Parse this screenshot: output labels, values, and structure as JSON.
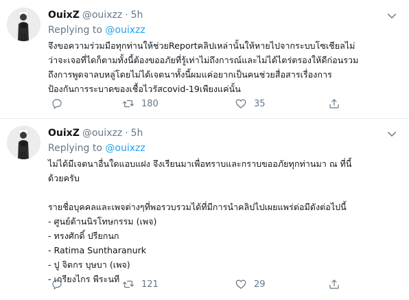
{
  "tweets": [
    {
      "author": {
        "name": "OuixZ",
        "handle": "@ouixzz",
        "time": "5h"
      },
      "replying": {
        "label": "Replying to",
        "mention": "@ouixzz"
      },
      "lines": [
        "จึงขอความร่วมมือทุกท่านให้ช่วยReportคลิปเหล่านั้นให้หายไปจากระบบโซเชียลไม่",
        "ว่าจะเจอที่ไดก็ตามทั้งนี้ต้องขออภัยที่รู้เท่าไม่ถึงการณ์และไม่ได้ไตร่ตรองให้ดีก่อนรวม",
        "ถึงการพูดจาลบหลู่โดยไม่ได้เจตนาทั้งนี้ผมแค่อยากเป็นคนช่วยสื่อสารเรื่องการ",
        "ป้องกันการระบาดของเชื้อไวรัสcovid-19เพียงแค่นั้น"
      ],
      "stats": {
        "retweets": "180",
        "likes": "35"
      }
    },
    {
      "author": {
        "name": "OuixZ",
        "handle": "@ouixzz",
        "time": "5h"
      },
      "replying": {
        "label": "Replying to",
        "mention": "@ouixzz"
      },
      "lines": [
        "ไม่ได้มีเจตนาอื่นใดแอบแฝง จึงเรียนมาเพื่อทราบและกราบขออภัยทุกท่านมา ณ ที่นี้",
        "ด้วยครับ",
        "รายชื่อบุคคลและเพจต่างๆที่พอรวบรวมได้ที่มีการนำคลิปไปเผยแพร่ต่อมีดังต่อไปนี้",
        "- ศูนย์ต้านนิรโทษกรรม (เพจ)",
        "- ทรงศักดิ์ ปรียกนก",
        "- Ratima Suntharanurk",
        "- ปู จิตกร บุษบา (เพจ)",
        "- เกรียงไกร พีระนที"
      ],
      "stats": {
        "retweets": "121",
        "likes": "29"
      }
    }
  ],
  "icons": {
    "caret": "chevron-down-icon",
    "reply": "reply-icon",
    "retweet": "retweet-icon",
    "like": "heart-icon",
    "share": "share-icon"
  },
  "colors": {
    "text": "#0f1419",
    "secondary": "#657786",
    "link": "#1da1f2",
    "divider": "#e6ecf0"
  }
}
